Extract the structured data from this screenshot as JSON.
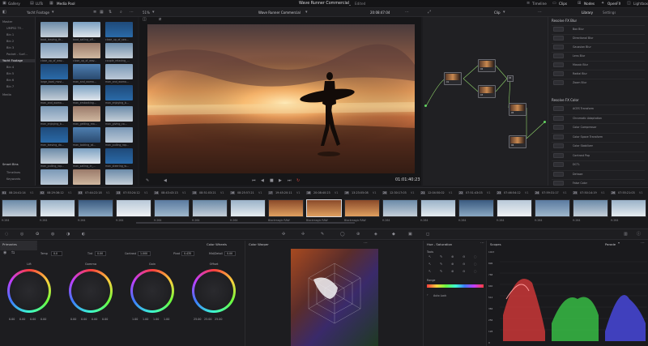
{
  "topbar": {
    "left_items": [
      "Gallery",
      "LUTs",
      "Media Pool"
    ],
    "project_title": "Wave Runner Commercial_",
    "project_status": "Edited",
    "right_items": [
      "Timeline",
      "Clips",
      "Nodes",
      "OpenFX",
      "Lightbox"
    ]
  },
  "subbar": {
    "pool_name": "Yacht Footage",
    "zoom": "51%",
    "timeline_name": "Wave Runner Commercial",
    "timecode": "20:08:47:04",
    "clip_mode": "Clip",
    "library_tab": "Library",
    "settings_tab": "Settings"
  },
  "bins": [
    "Master",
    "UMP52 TY...",
    "Bin 1",
    "Bin 2",
    "Bin 3",
    "Pocket - Surf...",
    "Yacht Footage",
    "Bin 4",
    "Bin 5",
    "Bin 6",
    "Bin 7",
    "Media"
  ],
  "smart_bins": {
    "title": "Smart Bins",
    "items": [
      "Timelines",
      "Keywords"
    ]
  },
  "clips": [
    "boat_leaving_th...",
    "boat_sailing_off...",
    "close_up_of_sea...",
    "close_up_of_wav...",
    "close_up_of_wav...",
    "couple_relaxing_...",
    "large_boat_movi...",
    "man_and_woma...",
    "man_and_woma...",
    "man_and_woma...",
    "man_embarking...",
    "man_enjoying_b...",
    "man_enjoying_b...",
    "man_getting_rea...",
    "man_giving_co...",
    "man_leaving_da...",
    "man_looking_at...",
    "man_pulling_rop...",
    "man_pulling_rop...",
    "man_sailing_in_...",
    "man_steering_w...",
    "",
    "",
    ""
  ],
  "viewer": {
    "timecode": "01:01:40:23"
  },
  "library": {
    "blur_header": "Resolve FX Blur",
    "blur_items": [
      "Box Blur",
      "Directional Blur",
      "Gaussian Blur",
      "Lens Blur",
      "Mosaic Blur",
      "Radial Blur",
      "Zoom Blur"
    ],
    "color_header": "Resolve FX Color",
    "color_items": [
      "ACES Transform",
      "Chromatic Adaptation",
      "Color Compressor",
      "Color Space Transform",
      "Color Stabilizer",
      "Contrast Pop",
      "DCTL",
      "Dehaze",
      "False Color"
    ]
  },
  "nodes": [
    "01",
    "02",
    "03",
    "04",
    "05",
    "06"
  ],
  "strip": [
    {
      "n": "01",
      "tc": "08:24:41:14",
      "v": "V1",
      "codec": "H.264"
    },
    {
      "n": "02",
      "tc": "08:29:36:12",
      "v": "V1",
      "codec": "H.264"
    },
    {
      "n": "03",
      "tc": "07:44:22:18",
      "v": "V1",
      "codec": "H.264"
    },
    {
      "n": "13",
      "tc": "07:53:24:12",
      "v": "V1",
      "codec": "H.264"
    },
    {
      "n": "14",
      "tc": "08:43:43:13",
      "v": "V1",
      "codec": "H.264"
    },
    {
      "n": "15",
      "tc": "08:51:03:21",
      "v": "V1",
      "codec": "H.264"
    },
    {
      "n": "16",
      "tc": "08:25:57:21",
      "v": "V1",
      "codec": "H.264"
    },
    {
      "n": "17",
      "tc": "19:45:20:11",
      "v": "V1",
      "codec": "Blackmagic RAW"
    },
    {
      "n": "18",
      "tc": "20:08:40:23",
      "v": "V1",
      "codec": "Blackmagic RAW"
    },
    {
      "n": "19",
      "tc": "13:23:05:08",
      "v": "V1",
      "codec": "Blackmagic RAW"
    },
    {
      "n": "20",
      "tc": "12:30:17:03",
      "v": "V1",
      "codec": "H.264"
    },
    {
      "n": "21",
      "tc": "12:04:50:02",
      "v": "V1",
      "codec": "H.264"
    },
    {
      "n": "22",
      "tc": "07:51:43:03",
      "v": "V1",
      "codec": "H.264"
    },
    {
      "n": "23",
      "tc": "07:46:54:12",
      "v": "V1",
      "codec": "H.264"
    },
    {
      "n": "24",
      "tc": "07:59:31:17",
      "v": "V1",
      "codec": "H.264"
    },
    {
      "n": "25",
      "tc": "07:50:14:19",
      "v": "V1",
      "codec": "H.264"
    },
    {
      "n": "26",
      "tc": "07:55:21:03",
      "v": "V1",
      "codec": "H.264"
    }
  ],
  "primaries": {
    "title": "Primaries",
    "mode": "Color Wheels",
    "temp_label": "Temp",
    "temp_val": "0.0",
    "tint_label": "Tint",
    "tint_val": "0.00",
    "contrast_label": "Contrast",
    "contrast_val": "1.000",
    "pivot_label": "Pivot",
    "pivot_val": "0.435",
    "middetail_label": "Mid/Detail",
    "middetail_val": "0.00",
    "wheels": [
      {
        "name": "Lift",
        "vals": [
          "0.00",
          "0.00",
          "0.00",
          "0.00"
        ]
      },
      {
        "name": "Gamma",
        "vals": [
          "0.00",
          "0.00",
          "0.00",
          "0.00"
        ]
      },
      {
        "name": "Gain",
        "vals": [
          "1.00",
          "1.00",
          "1.00",
          "1.00"
        ]
      },
      {
        "name": "Offset",
        "vals": [
          "25.00",
          "25.00",
          "25.00"
        ]
      }
    ]
  },
  "warper": {
    "title": "Color Warper"
  },
  "hue": {
    "title": "Hue - Saturation",
    "tools": "Tools",
    "range": "Range",
    "auto_lock": "Auto Lock"
  },
  "scopes": {
    "title": "Scopes",
    "mode": "Parade",
    "ticks": [
      "1023",
      "896",
      "768",
      "640",
      "512",
      "384",
      "256",
      "128",
      "0"
    ]
  },
  "colors": {
    "accent": "#d6453d",
    "lib_header": "#c9c9ce"
  }
}
